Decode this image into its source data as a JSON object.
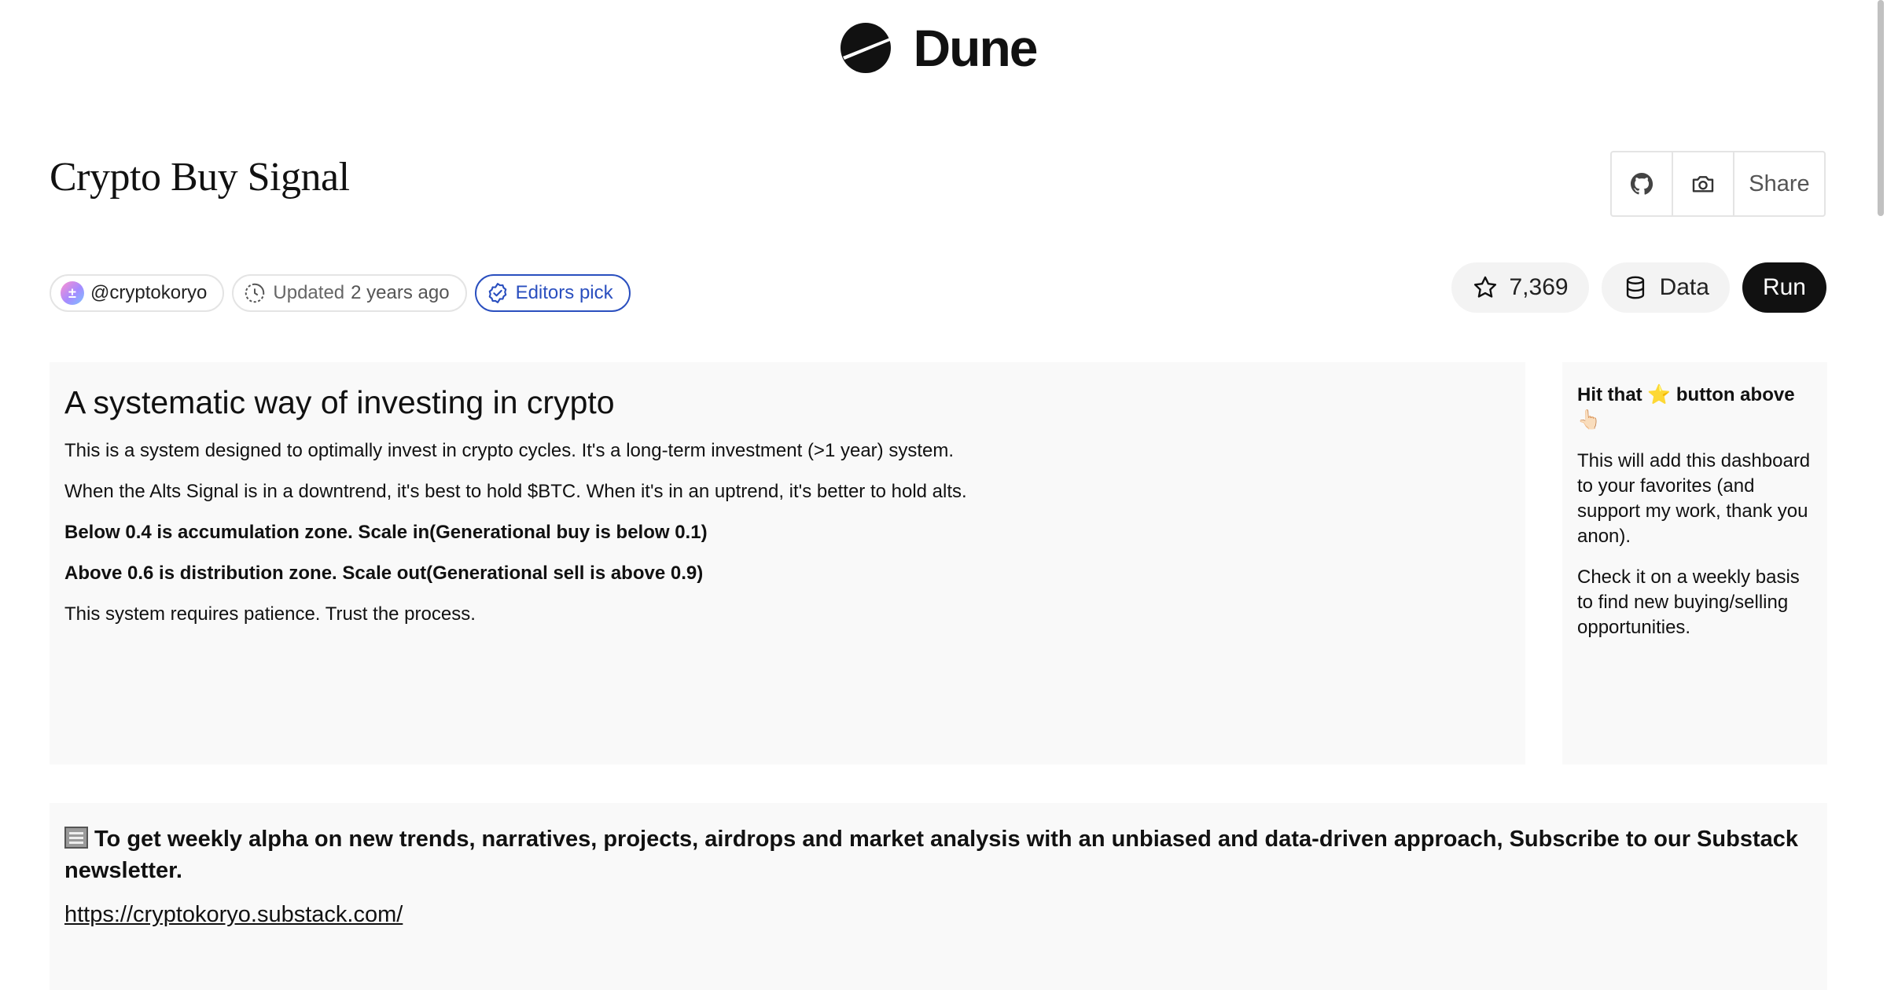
{
  "brand": {
    "name": "Dune"
  },
  "dashboard": {
    "title": "Crypto Buy Signal",
    "share_label": "Share"
  },
  "meta": {
    "author": "@cryptokoryo",
    "updated_label": "Updated",
    "updated_time": "2 years ago",
    "editors_pick": "Editors pick"
  },
  "actions": {
    "stars_count": "7,369",
    "data_label": "Data",
    "run_label": "Run"
  },
  "main_panel": {
    "heading": "A systematic way of investing in crypto",
    "paragraphs": [
      "This is a system designed to optimally invest in crypto cycles. It's a long-term investment (>1 year) system.",
      "When the Alts Signal is in a downtrend, it's best to hold $BTC. When it's in an uptrend, it's better to hold alts.",
      "Below 0.4 is accumulation zone. Scale in(Generational buy is below 0.1)",
      "Above 0.6 is distribution zone. Scale out(Generational sell is above 0.9)",
      "This system requires patience. Trust the process."
    ]
  },
  "side_panel": {
    "line1_pre": "Hit that",
    "line1_emoji": "⭐",
    "line1_post": "button above",
    "line1_emoji2": "👆🏻",
    "para2": "This will add this dashboard to your favorites (and support my work, thank you anon).",
    "para3": "Check it on a weekly basis to find new buying/selling opportunities."
  },
  "bottom_panel": {
    "text": "To get weekly alpha on new trends, narratives, projects, airdrops and market analysis with an unbiased and data-driven approach, Subscribe to our Substack newsletter.",
    "link": "https://cryptokoryo.substack.com/"
  },
  "colors": {
    "accent_blue": "#2a4fbf",
    "run_button": "#111111",
    "panel_bg": "#f9f9f9"
  }
}
